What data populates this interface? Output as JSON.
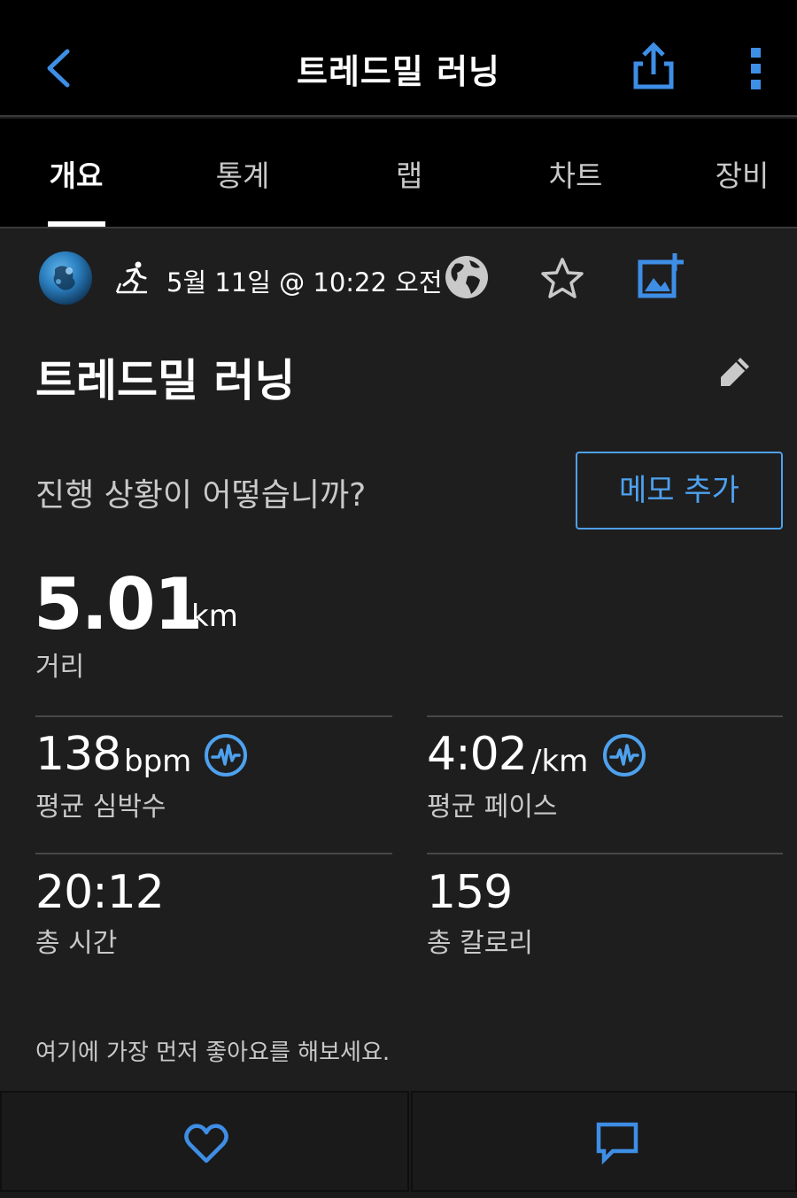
{
  "header": {
    "title": "트레드밀 러닝",
    "back_icon": "chevron-left-icon",
    "share_icon": "share-icon",
    "more_icon": "more-vertical-icon"
  },
  "tabs": [
    {
      "label": "개요",
      "active": true
    },
    {
      "label": "통계",
      "active": false
    },
    {
      "label": "랩",
      "active": false
    },
    {
      "label": "차트",
      "active": false
    },
    {
      "label": "장비",
      "active": false
    }
  ],
  "meta": {
    "activity_type_icon": "treadmill-run-icon",
    "date": "5월 11일 @ 10:22 오전",
    "privacy_icon": "globe-icon",
    "favorite_icon": "star-icon",
    "add_photo_icon": "add-photo-icon"
  },
  "activity": {
    "title": "트레드밀 러닝",
    "edit_icon": "pencil-icon"
  },
  "note": {
    "prompt": "진행 상황이 어떻습니까?",
    "button": "메모 추가"
  },
  "distance": {
    "value": "5.01",
    "unit": "km",
    "label": "거리"
  },
  "stats": {
    "heart_rate": {
      "value": "138",
      "unit": "bpm",
      "label": "평균 심박수"
    },
    "pace": {
      "value": "4:02",
      "unit": "/km",
      "label": "평균 페이스"
    },
    "time": {
      "value": "20:12",
      "label": "총 시간"
    },
    "calories": {
      "value": "159",
      "label": "총 칼로리"
    }
  },
  "social": {
    "likes_prompt": "여기에 가장 먼저 좋아요를 해보세요.",
    "like_icon": "heart-icon",
    "comment_icon": "comment-icon"
  },
  "colors": {
    "accent": "#4ea1ee",
    "background": "#1e1e1f",
    "header_background": "#000000",
    "secondary_text": "#c9c9c9"
  }
}
